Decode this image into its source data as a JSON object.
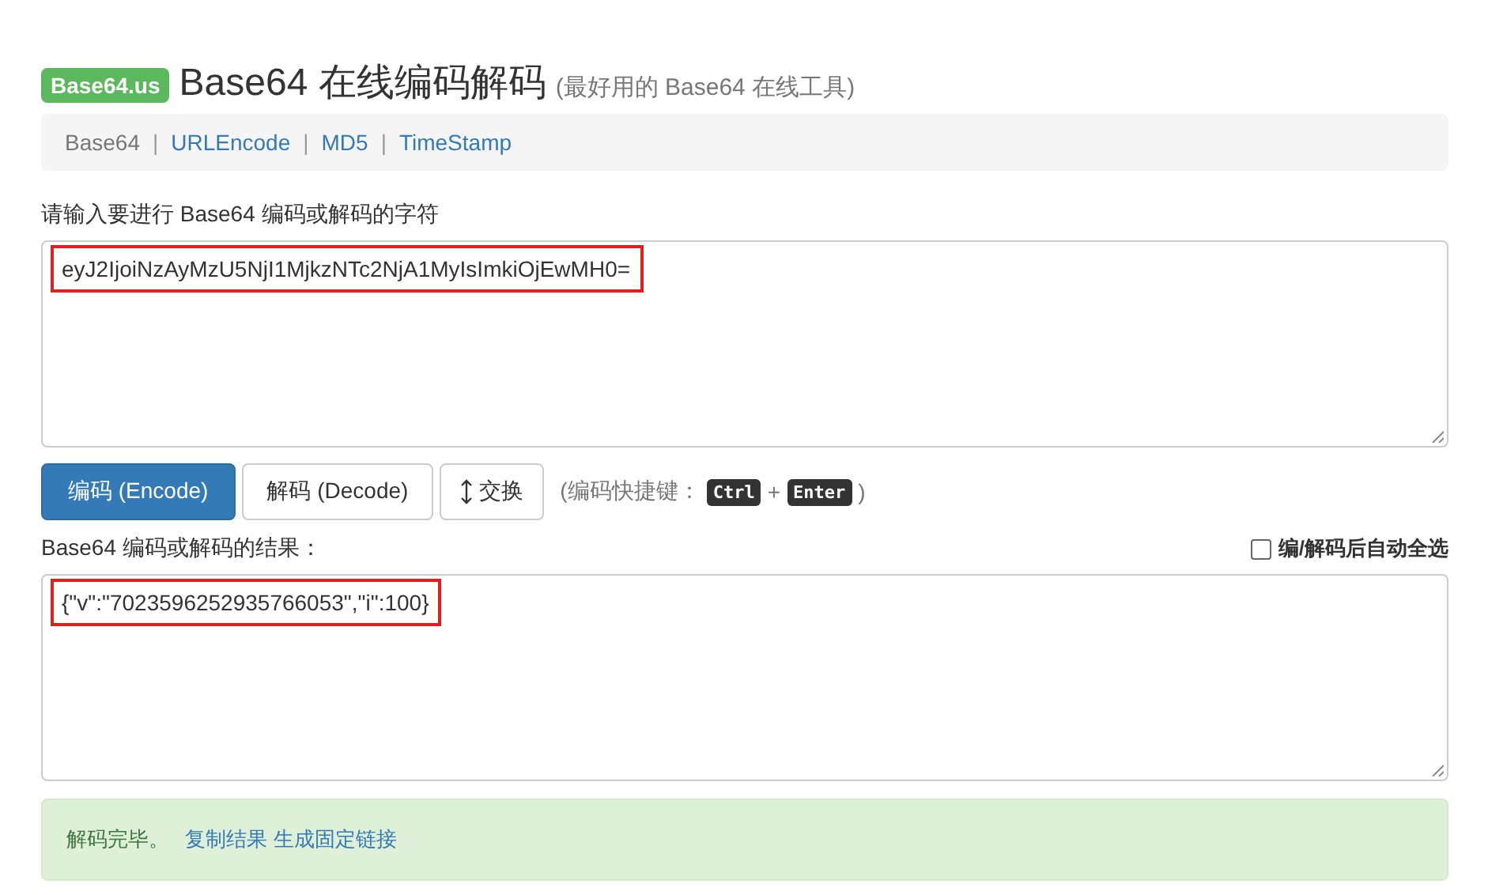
{
  "header": {
    "logo": "Base64.us",
    "title": "Base64 在线编码解码",
    "subtitle": "(最好用的 Base64 在线工具)"
  },
  "nav": [
    {
      "label": "Base64",
      "selected": true
    },
    {
      "label": "URLEncode",
      "selected": false
    },
    {
      "label": "MD5",
      "selected": false
    },
    {
      "label": "TimeStamp",
      "selected": false
    }
  ],
  "nav_separator": "|",
  "input": {
    "label": "请输入要进行 Base64 编码或解码的字符",
    "value": "eyJ2IjoiNzAyMzU5NjI1MjkzNTc2NjA1MyIsImkiOjEwMH0="
  },
  "buttons": [
    {
      "label": "编码 (Encode)",
      "kind": "primary"
    },
    {
      "label": "解码 (Decode)",
      "kind": "default"
    },
    {
      "label": "交换",
      "kind": "swap"
    }
  ],
  "shortcut": {
    "prefix": "(编码快捷键：",
    "keys": [
      "Ctrl",
      "Enter"
    ],
    "plus": "+",
    "suffix": ")"
  },
  "output": {
    "label": "Base64 编码或解码的结果：",
    "value": "{\"v\":\"7023596252935766053\",\"i\":100}"
  },
  "auto_select": {
    "label": "编/解码后自动全选",
    "checked": false
  },
  "alert": {
    "message": "解码完毕。",
    "links": [
      "复制结果",
      "生成固定链接"
    ]
  }
}
